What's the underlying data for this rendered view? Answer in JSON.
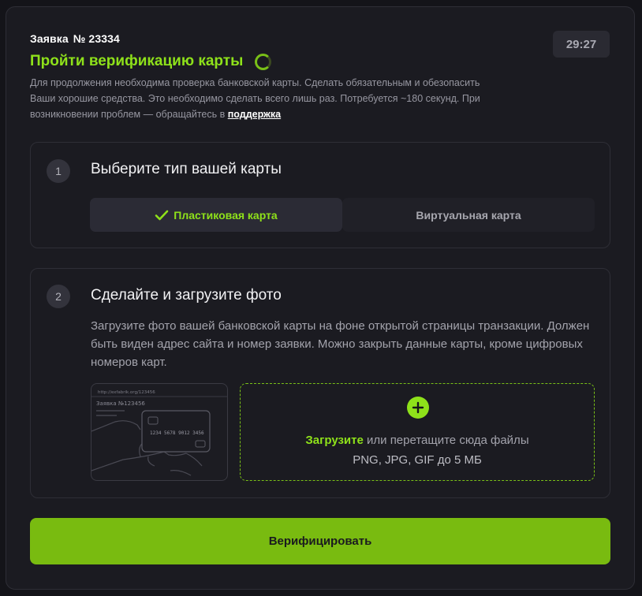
{
  "order": {
    "label": "Заявка",
    "number": "№ 23334"
  },
  "timer": "29:27",
  "title": "Пройти верификацию карты",
  "description": {
    "text": "Для продолжения необходима проверка банковской карты. Сделать обязательным и обезопасить Ваши хорошие средства. Это необходимо сделать всего лишь раз. Потребуется ~180 секунд. При возникновении проблем — обращайтесь в ",
    "link": "поддержка"
  },
  "step1": {
    "number": "1",
    "title": "Выберите тип вашей карты",
    "options": [
      {
        "label": "Пластиковая карта",
        "selected": true
      },
      {
        "label": "Виртуальная карта",
        "selected": false
      }
    ]
  },
  "step2": {
    "number": "2",
    "title": "Сделайте и загрузите фото",
    "instructions": "Загрузите фото вашей банковской карты на фоне открытой страницы транзакции. Должен быть виден адрес сайта и номер заявки. Можно закрыть данные карты, кроме цифровых номеров карт.",
    "sample": {
      "url": "http://exfabrik.org/123456",
      "order": "Заявка №123456",
      "card_number": "1234 5678 9012 3456"
    },
    "dropzone": {
      "upload_link": "Загрузите",
      "text": " или перетащите сюда файлы",
      "formats": "PNG, JPG, GIF до 5 МБ"
    }
  },
  "verify_button": "Верифицировать",
  "colors": {
    "accent": "#8ee11a",
    "button": "#79bb10",
    "background": "#1b1b21"
  },
  "icons": [
    "spinner-icon",
    "check-icon",
    "plus-icon"
  ]
}
